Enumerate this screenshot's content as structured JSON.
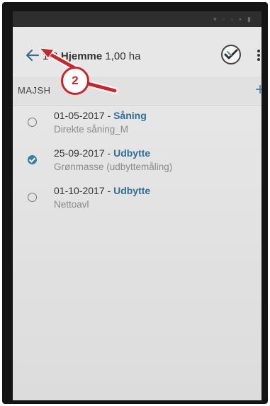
{
  "app_bar": {
    "title_prefix": "1-0 ",
    "title_name": "Hjemme",
    "title_area": " 1,00 ha"
  },
  "section": {
    "label": "MAJSH",
    "add_label": "+"
  },
  "items": [
    {
      "date": "01-05-2017",
      "sep": " - ",
      "type": "Såning",
      "detail": "Direkte såning_M",
      "checked": false
    },
    {
      "date": "25-09-2017",
      "sep": " - ",
      "type": "Udbytte",
      "detail": "Grønmasse (udbyttemåling)",
      "checked": true
    },
    {
      "date": "01-10-2017",
      "sep": " - ",
      "type": "Udbytte",
      "detail": "Nettoavl",
      "checked": false
    }
  ],
  "annotation": {
    "number": "2",
    "color": "#c8262c"
  },
  "colors": {
    "accent": "#3580a3",
    "type_text": "#2f6f95"
  }
}
